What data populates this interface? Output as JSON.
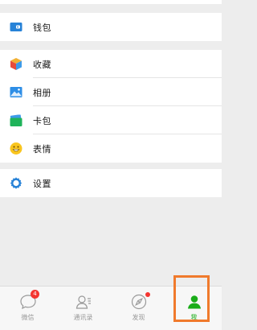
{
  "menu": {
    "wallet": {
      "label": "钱包",
      "icon": "wallet-icon"
    },
    "favorites": {
      "label": "收藏",
      "icon": "favorites-cube-icon"
    },
    "album": {
      "label": "相册",
      "icon": "photo-album-icon"
    },
    "cards": {
      "label": "卡包",
      "icon": "card-wallet-icon"
    },
    "stickers": {
      "label": "表情",
      "icon": "smiley-face-icon"
    },
    "settings": {
      "label": "设置",
      "icon": "gear-icon"
    }
  },
  "tabbar": {
    "chats": {
      "label": "微信",
      "badge": "4",
      "icon": "chat-bubble-icon"
    },
    "contacts": {
      "label": "通讯录",
      "icon": "contacts-icon"
    },
    "discover": {
      "label": "发现",
      "icon": "compass-icon",
      "has_dot": true
    },
    "me": {
      "label": "我",
      "icon": "person-icon",
      "active": true
    }
  },
  "colors": {
    "accent_green": "#1aad19",
    "badge_red": "#f43530",
    "highlight_orange": "#f07a2c",
    "background": "#ededed"
  }
}
